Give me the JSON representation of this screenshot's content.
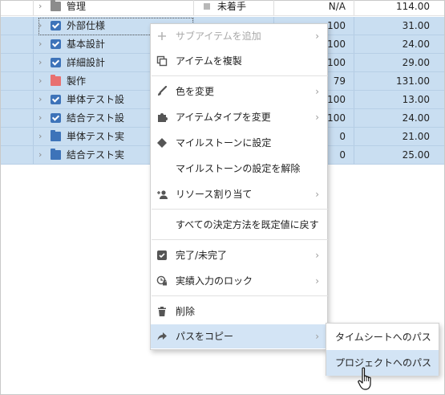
{
  "rows": [
    {
      "name": "管理",
      "status": "未着手",
      "pct": "N/A",
      "val": "114.00",
      "icon": "folder-gray",
      "selected": false
    },
    {
      "name": "外部仕様",
      "status": "",
      "pct": "100",
      "val": "31.00",
      "icon": "checkbox-checked",
      "selected": true
    },
    {
      "name": "基本設計",
      "status": "",
      "pct": "100",
      "val": "24.00",
      "icon": "checkbox-checked",
      "selected": true
    },
    {
      "name": "詳細設計",
      "status": "",
      "pct": "100",
      "val": "29.00",
      "icon": "checkbox-checked",
      "selected": true
    },
    {
      "name": "製作",
      "status": "",
      "pct": "79",
      "val": "131.00",
      "icon": "folder-red",
      "selected": true
    },
    {
      "name": "単体テスト設",
      "status": "",
      "pct": "100",
      "val": "13.00",
      "icon": "checkbox-checked",
      "selected": true
    },
    {
      "name": "結合テスト設",
      "status": "",
      "pct": "100",
      "val": "24.00",
      "icon": "checkbox-checked",
      "selected": true
    },
    {
      "name": "単体テスト実",
      "status": "",
      "pct": "0",
      "val": "21.00",
      "icon": "folder-blue",
      "selected": true
    },
    {
      "name": "結合テスト実",
      "status": "",
      "pct": "0",
      "val": "25.00",
      "icon": "folder-blue",
      "selected": true
    }
  ],
  "menu": {
    "add_subitem": "サブアイテムを追加",
    "duplicate": "アイテムを複製",
    "change_color": "色を変更",
    "change_type": "アイテムタイプを変更",
    "set_milestone": "マイルストーンに設定",
    "unset_milestone": "マイルストーンの設定を解除",
    "assign_resource": "リソース割り当て",
    "reset_methods": "すべての決定方法を既定値に戻す",
    "complete": "完了/未完了",
    "lock_actuals": "実績入力のロック",
    "delete": "削除",
    "copy_path": "パスをコピー"
  },
  "submenu": {
    "timesheet_path": "タイムシートへのパス",
    "project_path": "プロジェクトへのパス"
  },
  "colors": {
    "selection": "#c9def1",
    "menu_hover": "#d3e4f5",
    "checkbox": "#3d73b9",
    "folder_red": "#e87070",
    "folder_gray": "#8c8c8c"
  }
}
